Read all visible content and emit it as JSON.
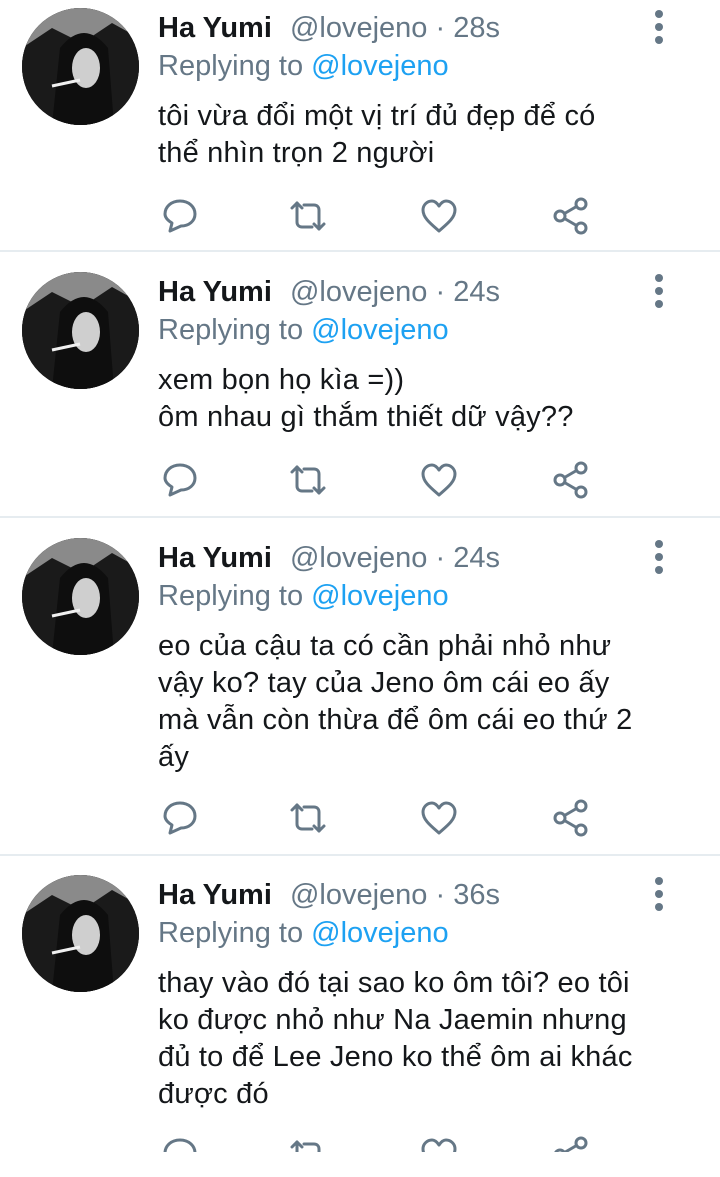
{
  "tweets": [
    {
      "name": "Ha Yumi",
      "handle": "@lovejeno",
      "dot": "·",
      "time": "28s",
      "replying_prefix": "Replying to",
      "replying_to": "@lovejeno",
      "lines": [
        "tôi vừa đổi một vị trí đủ đẹp để có",
        "thể nhìn trọn 2 người"
      ]
    },
    {
      "name": "Ha Yumi",
      "handle": "@lovejeno",
      "dot": "·",
      "time": "24s",
      "replying_prefix": "Replying to",
      "replying_to": "@lovejeno",
      "lines": [
        "xem bọn họ kìa =))",
        "ôm nhau gì thắm thiết dữ vậy??"
      ]
    },
    {
      "name": "Ha Yumi",
      "handle": "@lovejeno",
      "dot": "·",
      "time": "24s",
      "replying_prefix": "Replying to",
      "replying_to": "@lovejeno",
      "lines": [
        "eo của cậu ta có cần phải nhỏ như",
        "vậy ko? tay của Jeno ôm cái eo ấy",
        "mà vẫn còn thừa để ôm cái eo thứ 2",
        "ấy"
      ]
    },
    {
      "name": "Ha Yumi",
      "handle": "@lovejeno",
      "dot": "·",
      "time": "36s",
      "replying_prefix": "Replying to",
      "replying_to": "@lovejeno",
      "lines": [
        "thay vào đó tại sao ko ôm tôi? eo tôi",
        "ko được nhỏ như Na Jaemin nhưng",
        "đủ to để Lee Jeno ko thể ôm ai khác",
        "được đó"
      ]
    }
  ],
  "icons": {
    "reply": "comment-icon",
    "retweet": "retweet-icon",
    "like": "heart-icon",
    "share": "share-icon",
    "more": "more-vertical-icon"
  },
  "colors": {
    "accent": "#1da1f2",
    "secondary_text": "#657786",
    "icon": "#657786",
    "divider": "#e6ecf0"
  }
}
